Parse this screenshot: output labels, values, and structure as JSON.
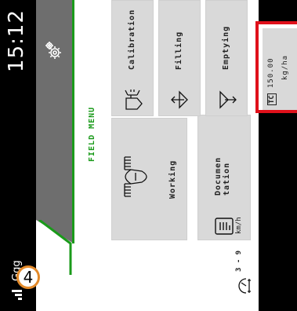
{
  "status_bar": {
    "time": "15:12",
    "user": "Ggg"
  },
  "page_number": "4",
  "menu": {
    "title": "FIELD MENU",
    "tiles": [
      {
        "label": "Calibration"
      },
      {
        "label": "Filling"
      },
      {
        "label": "Emptying"
      },
      {
        "label": "Working"
      },
      {
        "label": "Documen\ntation"
      }
    ]
  },
  "rate": {
    "tag": "TC",
    "value": "150.00",
    "unit": "kg/ha"
  },
  "speed": {
    "range": "3 - 9",
    "unit": "km/h"
  },
  "icons": {
    "settings": "gear-icon",
    "spreader": "spreader-icon",
    "documentation": "document-icon",
    "speed": "speedometer-icon"
  },
  "colors": {
    "accent_green": "#1a9a1a",
    "highlight_red": "#e0101a",
    "badge_orange": "#e38a2a",
    "header_grey": "#6e6e6e",
    "tile_grey": "#d9d9d9"
  }
}
